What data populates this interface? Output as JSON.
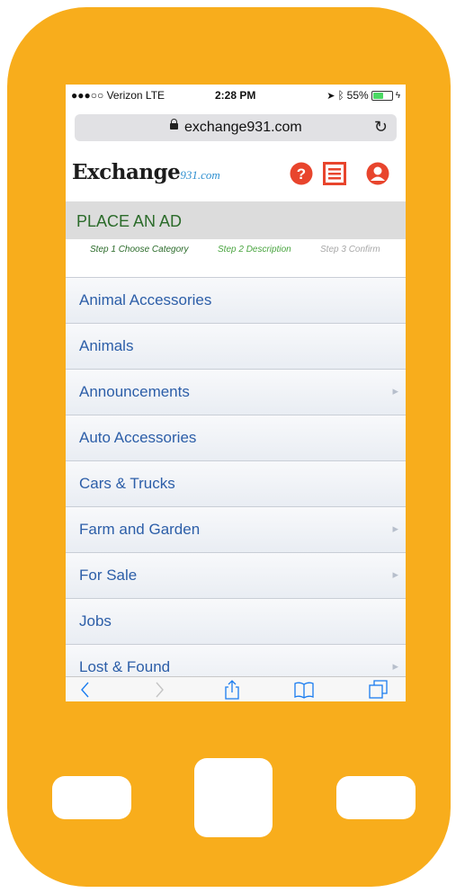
{
  "status": {
    "carrier": "●●●○○ Verizon  LTE",
    "time": "2:28 PM",
    "battery": "55%",
    "battery_level": 0.55
  },
  "browser": {
    "url": "exchange931.com",
    "toolbar_icons": [
      "back-icon",
      "forward-icon",
      "share-icon",
      "bookmarks-icon",
      "tabs-icon"
    ]
  },
  "site": {
    "logo_main": "Exchange",
    "logo_domain": "931.com",
    "header_icons": [
      "help-icon",
      "menu-icon",
      "account-icon"
    ],
    "accent_color": "#e8452d"
  },
  "page": {
    "title": "PLACE AN AD",
    "steps": [
      {
        "label": "Step 1 Choose Category",
        "color": "#2b6b2a"
      },
      {
        "label": "Step 2 Description",
        "color": "#4aa540"
      },
      {
        "label": "Step 3 Confirm",
        "color": "#a8a8a8"
      }
    ]
  },
  "categories": [
    {
      "label": "Animal Accessories",
      "has_sub": false
    },
    {
      "label": "Animals",
      "has_sub": false
    },
    {
      "label": "Announcements",
      "has_sub": true
    },
    {
      "label": "Auto Accessories",
      "has_sub": false
    },
    {
      "label": "Cars & Trucks",
      "has_sub": false
    },
    {
      "label": "Farm and Garden",
      "has_sub": true
    },
    {
      "label": "For Sale",
      "has_sub": true
    },
    {
      "label": "Jobs",
      "has_sub": false
    },
    {
      "label": "Lost & Found",
      "has_sub": true
    }
  ],
  "phone_color": "#f8ad1c"
}
